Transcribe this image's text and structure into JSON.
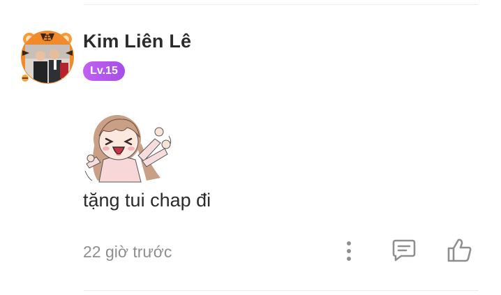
{
  "comment": {
    "username": "Kim Liên Lê",
    "level": "Lv.15",
    "text": "tặng tui chap đi",
    "timestamp": "22 giờ trước"
  },
  "icons": {
    "more": "more-vertical-icon",
    "reply": "comment-reply-icon",
    "like": "thumbs-up-icon"
  },
  "colors": {
    "level_badge": "#b458ec",
    "icon_gray": "#8f8f8f",
    "text_primary": "#2b2b2b",
    "text_secondary": "#8e8e8e"
  }
}
